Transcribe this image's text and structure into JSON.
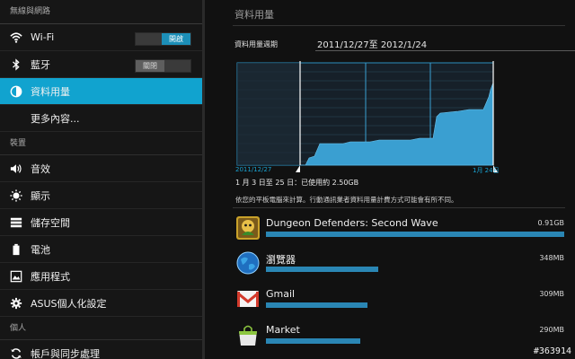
{
  "sidebar": {
    "sections": {
      "wireless": "無線與網路",
      "device": "裝置",
      "personal": "個人"
    },
    "items": {
      "wifi": {
        "label": "Wi-Fi",
        "toggle": "開啟"
      },
      "bluetooth": {
        "label": "藍牙",
        "toggle": "關閉"
      },
      "data_usage": {
        "label": "資料用量"
      },
      "more": {
        "label": "更多內容..."
      },
      "sound": {
        "label": "音效"
      },
      "display": {
        "label": "顯示"
      },
      "storage": {
        "label": "儲存空間"
      },
      "battery": {
        "label": "電池"
      },
      "apps": {
        "label": "應用程式"
      },
      "asus": {
        "label": "ASUS個人化設定"
      },
      "accounts": {
        "label": "帳戶與同步處理"
      }
    }
  },
  "main": {
    "title": "資料用量",
    "cycle_label": "資料用量週期",
    "cycle_value": "2011/12/27至 2012/1/24",
    "chart_start_date": "2011/12/27",
    "chart_end_date": "1月 24日",
    "usage_summary": "1 月 3 日至 25 日：已使用約 2.50GB",
    "usage_note": "依您的平板電腦來計算。行動通訊業者資料用量計費方式可能會有所不同。",
    "apps": [
      {
        "name": "Dungeon Defenders: Second Wave",
        "size": "0.91GB",
        "fraction": 1.0
      },
      {
        "name": "瀏覽器",
        "size": "348MB",
        "fraction": 0.375
      },
      {
        "name": "Gmail",
        "size": "309MB",
        "fraction": 0.34
      },
      {
        "name": "Market",
        "size": "290MB",
        "fraction": 0.315
      }
    ]
  },
  "colors": {
    "accent": "#11a3cf",
    "chart_fill": "#3a9fd1",
    "bar": "#2a86b4"
  },
  "watermark": "#363914"
}
